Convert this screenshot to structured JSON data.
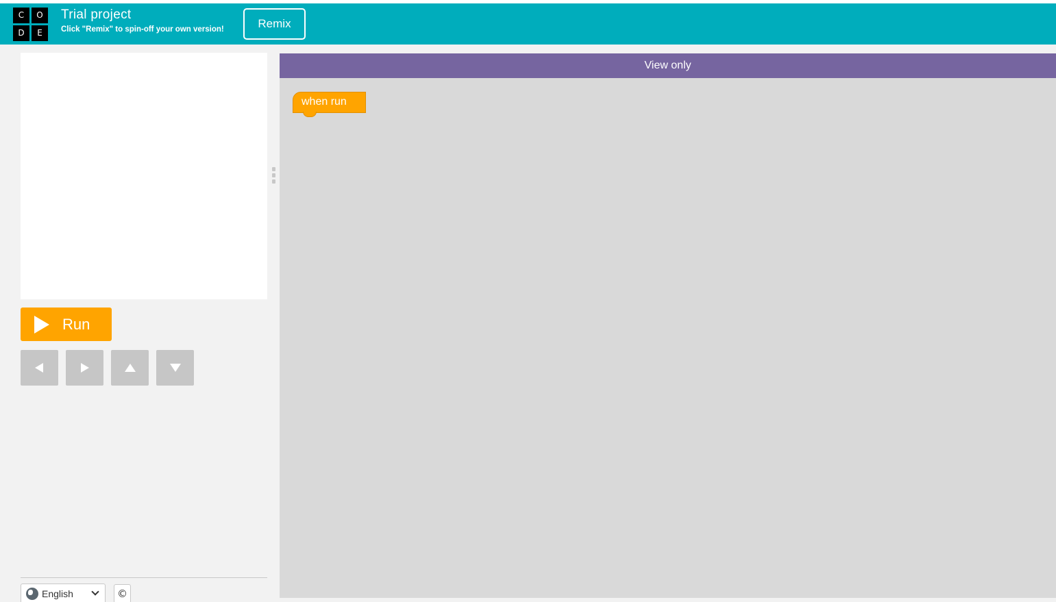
{
  "header": {
    "logo_letters": [
      "C",
      "O",
      "D",
      "E"
    ],
    "title": "Trial project",
    "subtitle": "Click \"Remix\" to spin-off your own version!",
    "remix_label": "Remix",
    "background_color": "#00adbc"
  },
  "controls": {
    "run_label": "Run",
    "run_icon": "play-icon",
    "run_color": "#ffa400",
    "arrow_buttons": [
      "left-arrow-icon",
      "right-arrow-icon",
      "up-arrow-icon",
      "down-arrow-icon"
    ]
  },
  "footer": {
    "language": "English",
    "copyright_symbol": "©"
  },
  "workspace": {
    "header_label": "View only",
    "header_color": "#7665a0",
    "blocks": [
      {
        "label": "when run",
        "color": "#ffa400"
      }
    ]
  }
}
